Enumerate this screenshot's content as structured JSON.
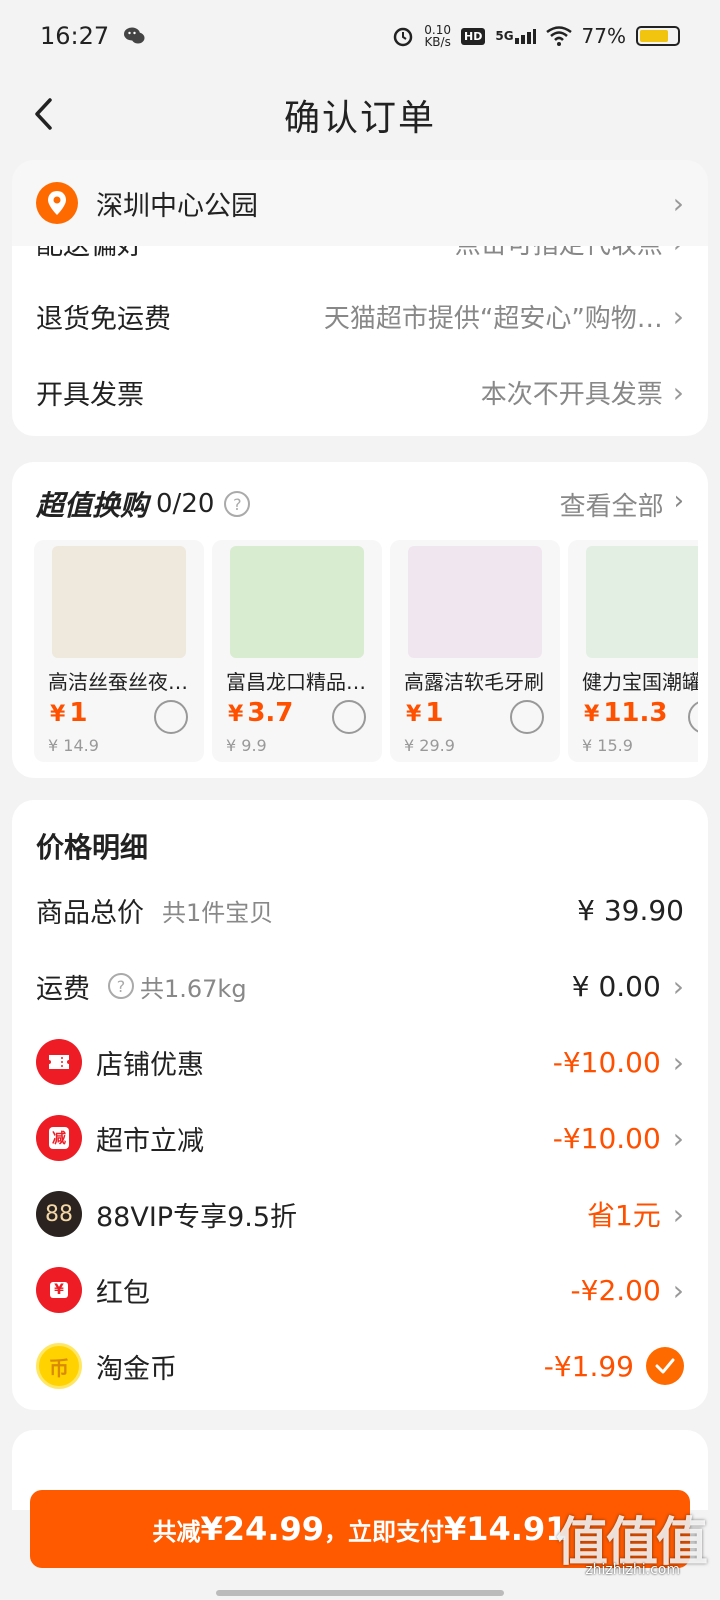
{
  "status_bar": {
    "time": "16:27",
    "net_speed_value": "0.10",
    "net_speed_unit": "KB/s",
    "hd": "HD",
    "signal": "5G",
    "battery": "77%",
    "battery_level": 0.77
  },
  "nav": {
    "title": "确认订单"
  },
  "address": {
    "text": "深圳中心公园"
  },
  "order_rows": {
    "delivery_label": "配送偏好",
    "delivery_value": "点击可指定代收点",
    "return_label": "退货免运费",
    "return_value": "天猫超市提供“超安心”购物…",
    "invoice_label": "开具发票",
    "invoice_value": "本次不开具发票"
  },
  "swap": {
    "title": "超值换购",
    "count": "0/20",
    "view_all": "查看全部",
    "products": [
      {
        "name": "高洁丝蚕丝夜安裤",
        "price": "1",
        "orig": "¥ 14.9",
        "img_color": "#efe8dc"
      },
      {
        "name": "富昌龙口精品粉丝",
        "price": "3.7",
        "orig": "¥ 9.9",
        "img_color": "#d8ecd0"
      },
      {
        "name": "高露洁软毛牙刷",
        "price": "1",
        "orig": "¥ 29.9",
        "img_color": "#f0e6ef"
      },
      {
        "name": "健力宝国潮罐",
        "price": "11.3",
        "orig": "¥ 15.9",
        "img_color": "#e4efe4"
      }
    ],
    "currency": "¥"
  },
  "price_detail": {
    "title": "价格明细",
    "goods_label": "商品总价",
    "goods_sub": "共1件宝贝",
    "goods_value": "¥ 39.90",
    "shipping_label": "运费",
    "shipping_sub": "共1.67kg",
    "shipping_value": "¥ 0.00",
    "store_label": "店铺优惠",
    "store_value": "-¥10.00",
    "market_label": "超市立减",
    "market_icon": "减",
    "market_value": "-¥10.00",
    "vip_label": "88VIP专享9.5折",
    "vip_icon": "88",
    "vip_value": "省1元",
    "redpacket_label": "红包",
    "redpacket_icon": "¥",
    "redpacket_value": "-¥2.00",
    "coin_label": "淘金币",
    "coin_icon": "币",
    "coin_value": "-¥1.99"
  },
  "pay": {
    "prefix": "共减",
    "discount": "¥24.99",
    "separator": "，立即支付",
    "amount": "¥14.91"
  },
  "watermark": {
    "main": "值值值",
    "sub": "zhizhizhi.com"
  },
  "colors": {
    "accent": "#ff5000",
    "button": "#ff5a00"
  }
}
